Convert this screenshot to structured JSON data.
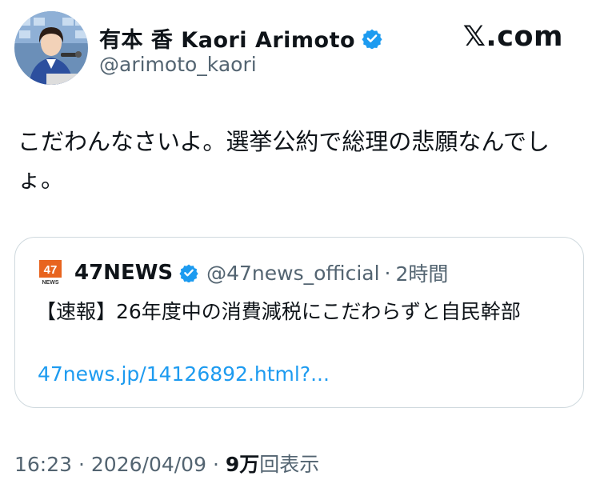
{
  "colors": {
    "text": "#0f1419",
    "secondary": "#536471",
    "link": "#1d9bf0",
    "verified": "#1d9bf0",
    "border": "#cfd9de"
  },
  "author": {
    "display_name": "有本 香 Kaori Arimoto",
    "handle": "@arimoto_kaori",
    "verified_icon": "verified-badge-icon",
    "avatar_icon": "avatar"
  },
  "brand": "𝕏.com",
  "tweet": {
    "text": "こだわんなさいよ。選挙公約で総理の悲願なんでしょ。"
  },
  "quote": {
    "logo_icon": "47news-logo-icon",
    "name": "47NEWS",
    "handle": "@47news_official",
    "separator": "·",
    "time": "2時間",
    "text": "【速報】26年度中の消費減税にこだわらずと自民幹部",
    "link": "47news.jp/14126892.html?..."
  },
  "meta": {
    "time": "16:23",
    "separator": "·",
    "date": "2026/04/09",
    "views_count": "9万",
    "views_label": "回表示"
  }
}
